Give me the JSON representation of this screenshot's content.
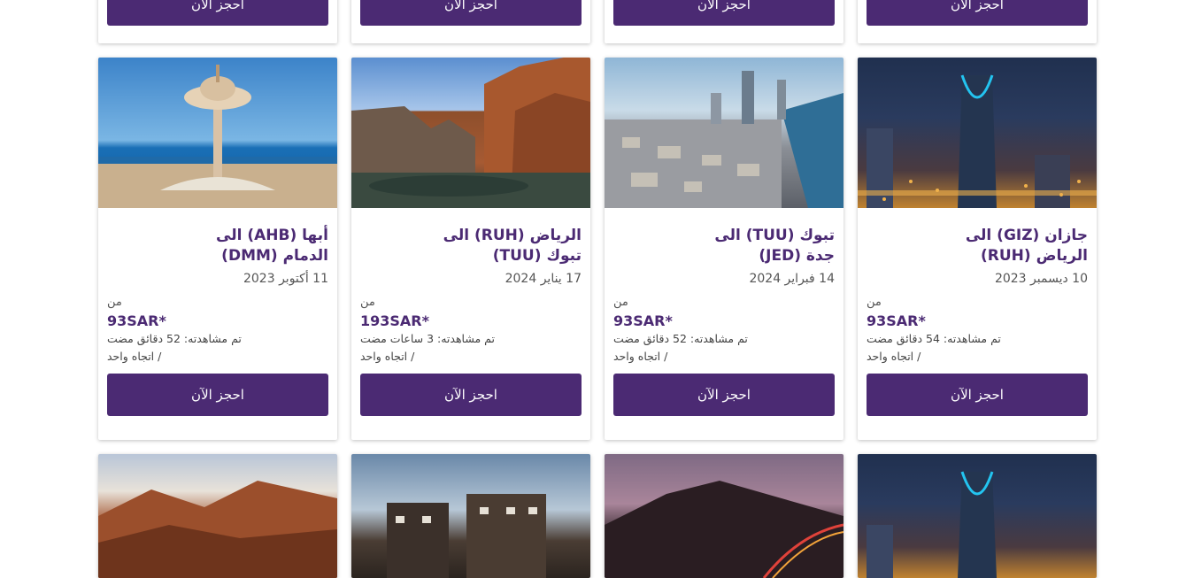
{
  "book_label": "احجز الآن",
  "from_label": "من",
  "top_row": [
    {},
    {},
    {},
    {}
  ],
  "cards": [
    {
      "title_line1": "أبها (AHB) الى",
      "title_line2": "الدمام (DMM)",
      "date": "11 أكتوبر 2023",
      "price": "93SAR*",
      "viewed": "تم مشاهدته: 52 دقائق مضت",
      "trip": "اتجاه واحد  /",
      "image": "khobar-water-tower"
    },
    {
      "title_line1": "الرياض (RUH) الى",
      "title_line2": "تبوك (TUU)",
      "date": "17 يناير 2024",
      "price": "193SAR*",
      "viewed": "تم مشاهدته: 3 ساعات مضت",
      "trip": "اتجاه واحد  /",
      "image": "canyon-oasis"
    },
    {
      "title_line1": "تبوك (TUU) الى",
      "title_line2": "جدة (JED)",
      "date": "14 فبراير 2024",
      "price": "93SAR*",
      "viewed": "تم مشاهدته: 52 دقائق مضت",
      "trip": "اتجاه واحد  /",
      "image": "jeddah-coastline"
    },
    {
      "title_line1": "جازان (GIZ) الى",
      "title_line2": "الرياض (RUH)",
      "date": "10 ديسمبر 2023",
      "price": "93SAR*",
      "viewed": "تم مشاهدته: 54 دقائق مضت",
      "trip": "اتجاه واحد  /",
      "image": "riyadh-kingdom-tower-night"
    }
  ],
  "bottom_row": [
    {
      "image": "red-mountains"
    },
    {
      "image": "stone-village"
    },
    {
      "image": "mountain-road-dusk"
    },
    {
      "image": "riyadh-kingdom-tower-night"
    }
  ],
  "colors": {
    "brand_purple": "#4b2a73",
    "background": "#ffffff"
  }
}
